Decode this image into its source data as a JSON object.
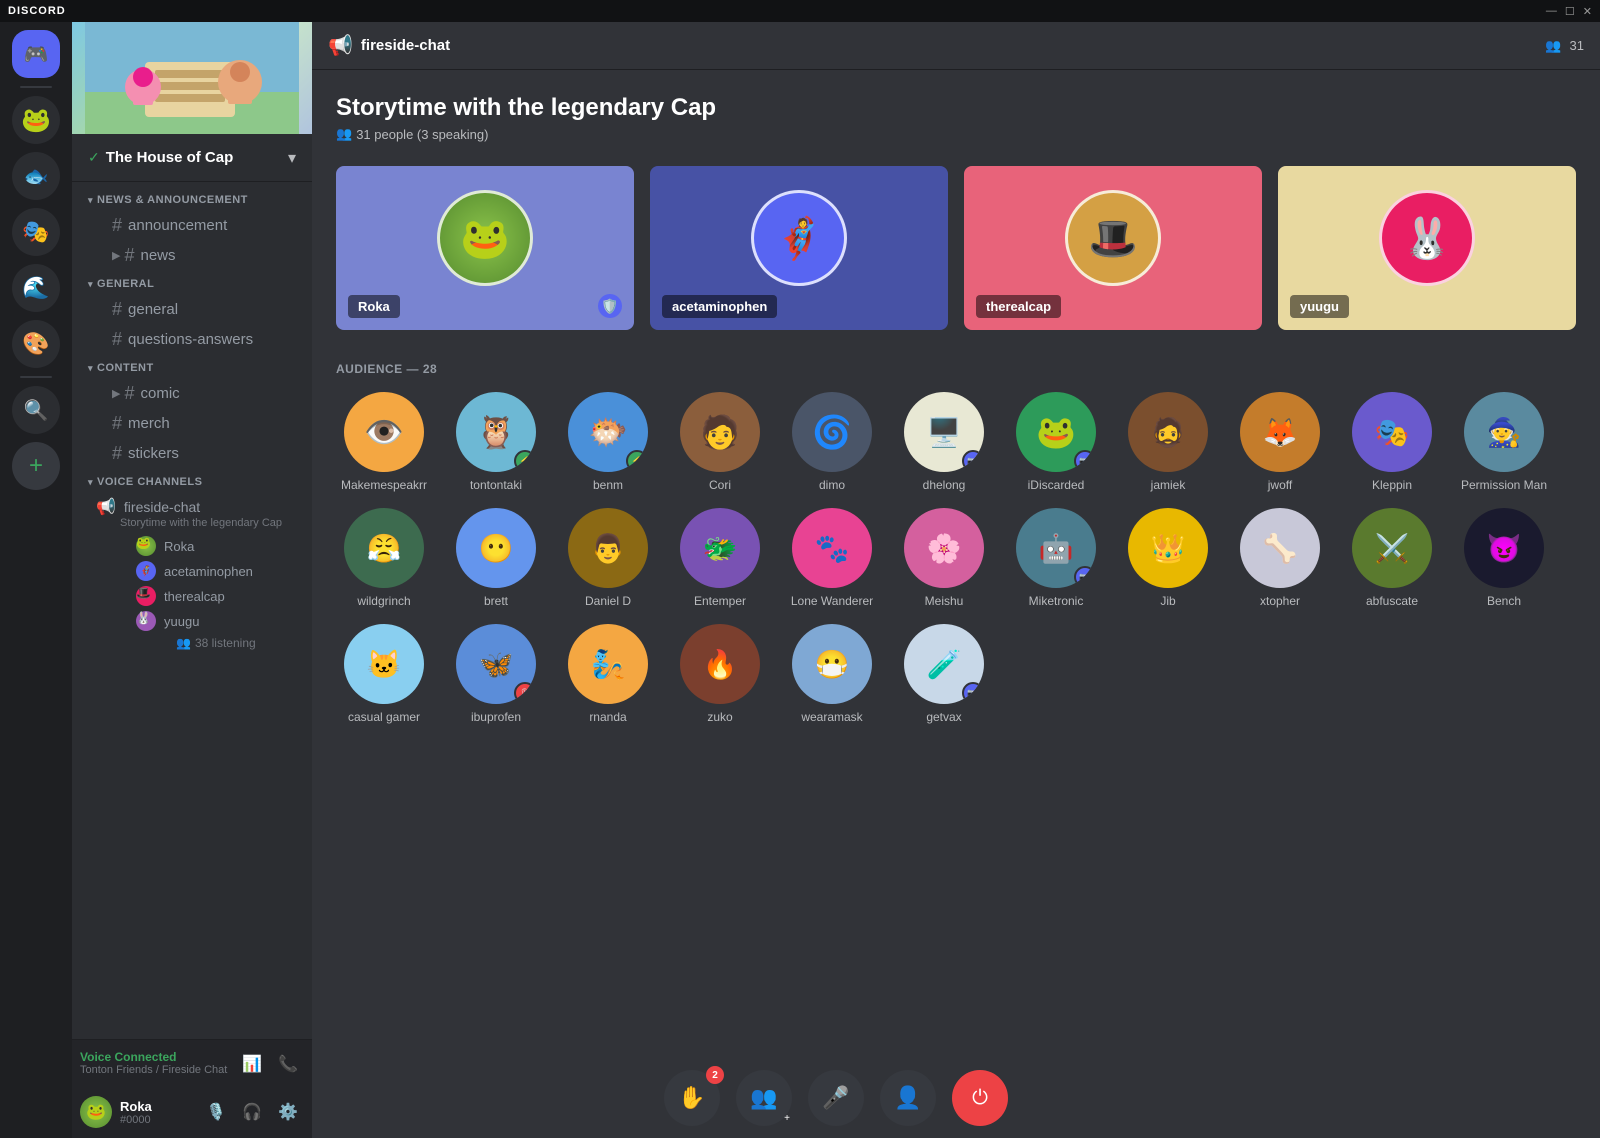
{
  "titlebar": {
    "brand": "DISCORD",
    "controls": [
      "—",
      "☐",
      "✕"
    ]
  },
  "server_list": {
    "icons": [
      {
        "id": "home",
        "label": "Home",
        "symbol": "🏠"
      },
      {
        "id": "server1",
        "label": "Server 1",
        "color": "#5865f2"
      },
      {
        "id": "server2",
        "label": "Server 2",
        "color": "#3ba55d"
      },
      {
        "id": "server3",
        "label": "Server 3",
        "color": "#f48c42"
      },
      {
        "id": "server4",
        "label": "Server 4",
        "color": "#ed4245"
      },
      {
        "id": "search",
        "label": "Search",
        "symbol": "🔍"
      },
      {
        "id": "add",
        "label": "Add Server",
        "symbol": "+"
      }
    ]
  },
  "sidebar": {
    "server_name": "The House of Cap",
    "categories": [
      {
        "id": "news",
        "label": "NEWS & ANNOUNCEMENT",
        "channels": [
          {
            "id": "announcement",
            "label": "announcement",
            "type": "text"
          },
          {
            "id": "news",
            "label": "news",
            "type": "text"
          }
        ]
      },
      {
        "id": "general",
        "label": "GENERAL",
        "channels": [
          {
            "id": "general",
            "label": "general",
            "type": "text"
          },
          {
            "id": "questions-answers",
            "label": "questions-answers",
            "type": "text"
          }
        ]
      },
      {
        "id": "content",
        "label": "CONTENT",
        "channels": [
          {
            "id": "comic",
            "label": "comic",
            "type": "text"
          },
          {
            "id": "merch",
            "label": "merch",
            "type": "text"
          },
          {
            "id": "stickers",
            "label": "stickers",
            "type": "text"
          }
        ]
      },
      {
        "id": "voice",
        "label": "VOICE CHANNELS",
        "channels": [
          {
            "id": "fireside-chat",
            "label": "fireside-chat",
            "type": "voice",
            "subtitle": "Storytime with the legendary Cap",
            "users": [
              "Roka",
              "acetaminophen",
              "therealcap",
              "yuugu"
            ],
            "listeners": 38
          }
        ]
      }
    ],
    "voice_connected": {
      "title": "Voice Connected",
      "subtitle": "Tonton Friends / Fireside Chat"
    },
    "user": {
      "name": "Roka",
      "tag": "#0000"
    }
  },
  "channel_header": {
    "icon": "📢",
    "name": "fireside-chat",
    "listener_count": "31"
  },
  "stage": {
    "title": "Storytime with the legendary Cap",
    "meta": "31 people (3 speaking)",
    "speakers": [
      {
        "id": "roka",
        "name": "Roka",
        "color": "blue",
        "has_mod": true
      },
      {
        "id": "acetaminophen",
        "name": "acetaminophen",
        "color": "dark-blue",
        "has_mod": false
      },
      {
        "id": "therealcap",
        "name": "therealcap",
        "color": "pink",
        "has_mod": false
      },
      {
        "id": "yuugu",
        "name": "yuugu",
        "color": "yellow",
        "has_mod": false
      }
    ],
    "audience_label": "AUDIENCE — 28",
    "audience": [
      {
        "id": "makemespeakrr",
        "name": "Makemespeakrr"
      },
      {
        "id": "tontontaki",
        "name": "tontontaki",
        "badge": "boost"
      },
      {
        "id": "benm",
        "name": "benm",
        "badge": "boost"
      },
      {
        "id": "cori",
        "name": "Cori"
      },
      {
        "id": "dimo",
        "name": "dimo"
      },
      {
        "id": "dhelong",
        "name": "dhelong",
        "badge": "cam"
      },
      {
        "id": "idiscarded",
        "name": "iDiscarded",
        "badge": "cam"
      },
      {
        "id": "jamiek",
        "name": "jamiek"
      },
      {
        "id": "jwoff",
        "name": "jwoff"
      },
      {
        "id": "kleppin",
        "name": "Kleppin"
      },
      {
        "id": "permission-man",
        "name": "Permission Man"
      },
      {
        "id": "wildgrinch",
        "name": "wildgrinch"
      },
      {
        "id": "brett",
        "name": "brett"
      },
      {
        "id": "daniel-d",
        "name": "Daniel D"
      },
      {
        "id": "entemper",
        "name": "Entemper"
      },
      {
        "id": "lone-wanderer",
        "name": "Lone Wanderer"
      },
      {
        "id": "meishu",
        "name": "Meishu"
      },
      {
        "id": "miketronic",
        "name": "Miketronic",
        "badge": "cam"
      },
      {
        "id": "jib",
        "name": "Jib"
      },
      {
        "id": "xtopher",
        "name": "xtopher"
      },
      {
        "id": "abfuscate",
        "name": "abfuscate"
      },
      {
        "id": "bench",
        "name": "Bench"
      },
      {
        "id": "casual-gamer",
        "name": "casual gamer"
      },
      {
        "id": "ibuprofen",
        "name": "ibuprofen",
        "badge": "mic"
      },
      {
        "id": "rnanda",
        "name": "rnanda"
      },
      {
        "id": "zuko",
        "name": "zuko"
      },
      {
        "id": "wearamask",
        "name": "wearamask"
      },
      {
        "id": "getvax",
        "name": "getvax",
        "badge": "cam"
      }
    ]
  },
  "controls": {
    "raise_hand": "✋",
    "invite": "👤+",
    "mic": "🎤",
    "add_speaker": "👤",
    "leave": "→",
    "hand_badge": "2"
  }
}
